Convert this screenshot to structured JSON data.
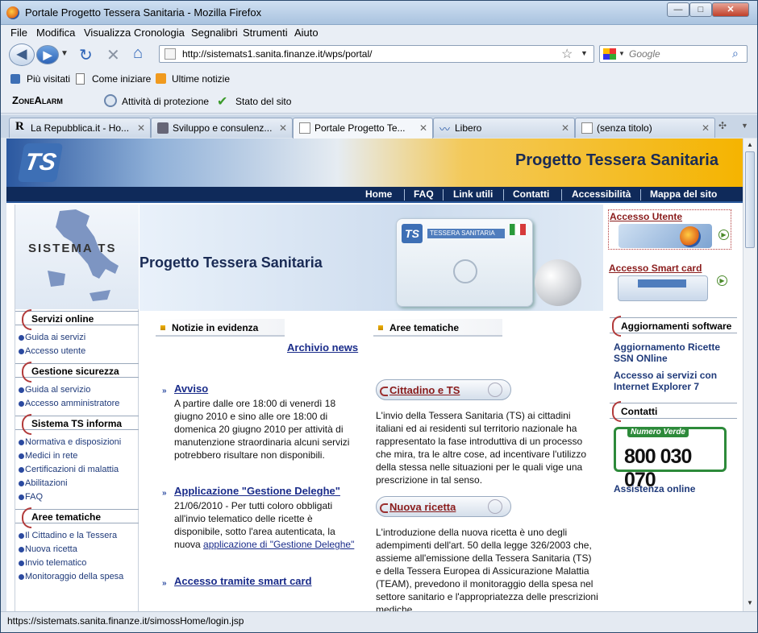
{
  "window": {
    "title": "Portale Progetto Tessera Sanitaria - Mozilla Firefox",
    "min": "—",
    "max": "□",
    "close": "✕"
  },
  "menu": [
    "File",
    "Modifica",
    "Visualizza",
    "Cronologia",
    "Segnalibri",
    "Strumenti",
    "Aiuto"
  ],
  "url": "http://sistemats1.sanita.finanze.it/wps/portal/",
  "search_placeholder": "Google",
  "bookmarks": [
    "Più visitati",
    "Come iniziare",
    "Ultime notizie"
  ],
  "zonealarm": {
    "brand": "ZoneAlarm",
    "activity": "Attività di protezione",
    "site": "Stato del sito"
  },
  "tabs": [
    {
      "label": "La Repubblica.it - Ho..."
    },
    {
      "label": "Sviluppo e consulenz..."
    },
    {
      "label": "Portale Progetto Te..."
    },
    {
      "label": "Libero"
    },
    {
      "label": "(senza titolo)"
    }
  ],
  "page": {
    "banner_title": "Progetto Tessera Sanitaria",
    "logo_text": "TS",
    "topnav": [
      "Home",
      "FAQ",
      "Link utili",
      "Contatti",
      "Accessibilità",
      "Mappa del sito"
    ],
    "sistema_ts": "SISTEMA TS",
    "left": {
      "s1": "Servizi online",
      "s1_links": [
        "Guida ai servizi",
        "Accesso utente"
      ],
      "s2": "Gestione sicurezza",
      "s2_links": [
        "Guida al servizio",
        "Accesso amministratore"
      ],
      "s3": "Sistema TS informa",
      "s3_links": [
        "Normativa e disposizioni",
        "Medici in rete",
        "Certificazioni di malattia",
        "Abilitazioni",
        "FAQ"
      ],
      "s4": "Aree tematiche",
      "s4_links": [
        "Il Cittadino e la Tessera",
        "Nuova ricetta",
        "Invio telematico",
        "Monitoraggio della spesa"
      ]
    },
    "hero_title": "Progetto Tessera Sanitaria",
    "card_title": "TESSERA SANITARIA",
    "news_head": "Notizie in evidenza",
    "archivio": "Archivio news",
    "news": [
      {
        "title": "Avviso",
        "text": "A partire dalle ore 18:00 di venerdì 18 giugno 2010 e sino alle ore 18:00 di domenica 20 giugno 2010 per attività di manutenzione straordinaria alcuni servizi potrebbero risultare non disponibili."
      },
      {
        "title": "Applicazione \"Gestione Deleghe\"",
        "text_a": "21/06/2010 - Per tutti coloro obbligati all'invio telematico delle ricette è disponibile, sotto l'area autenticata, la nuova ",
        "link": "applicazione di \"Gestione Deleghe\""
      },
      {
        "title": "Accesso tramite smart card"
      }
    ],
    "aree_head": "Aree tematiche",
    "aree": [
      {
        "title": "Cittadino e TS",
        "text": "L'invio della Tessera Sanitaria (TS) ai cittadini italiani ed ai residenti sul territorio nazionale ha rappresentato la fase introduttiva di un processo che mira, tra le altre cose, ad incentivare l'utilizzo della stessa nelle situazioni per le quali vige una prescrizione in tal senso."
      },
      {
        "title": "Nuova ricetta",
        "text": "L'introduzione della nuova ricetta è uno degli adempimenti dell'art. 50 della legge 326/2003 che, assieme all'emissione della Tessera Sanitaria (TS) e della Tessera Europea di Assicurazione Malattia (TEAM), prevedono il monitoraggio della spesa nel settore sanitario e l'appropriatezza delle prescrizioni mediche."
      }
    ],
    "right": {
      "accesso_utente": "Accesso Utente",
      "accesso_smart": "Accesso Smart card",
      "agg_head": "Aggiornamenti software",
      "agg_links": [
        "Aggiornamento Ricette SSN ONline",
        "Accesso ai servizi con Internet Explorer 7"
      ],
      "contatti_head": "Contatti",
      "numero_verde_label": "Numero Verde",
      "numero_verde": "800 030 070",
      "assistenza": "Assistenza online"
    }
  },
  "status": "https://sistemats.sanita.finanze.it/simossHome/login.jsp"
}
